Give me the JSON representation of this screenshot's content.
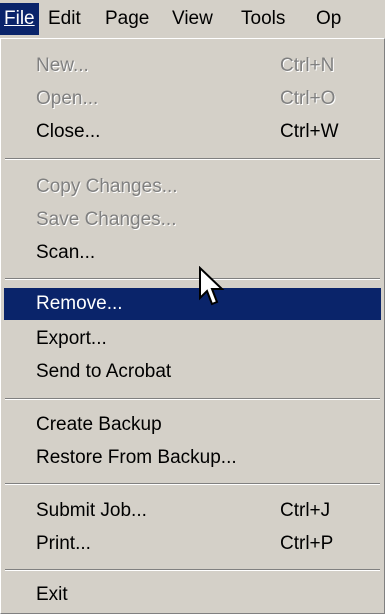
{
  "menubar": {
    "items": [
      {
        "label": "File",
        "active": true
      },
      {
        "label": "Edit"
      },
      {
        "label": "Page"
      },
      {
        "label": "View"
      },
      {
        "label": "Tools"
      },
      {
        "label": "Op"
      }
    ]
  },
  "menu": {
    "new": {
      "label": "New...",
      "shortcut": "Ctrl+N"
    },
    "open": {
      "label": "Open...",
      "shortcut": "Ctrl+O"
    },
    "close": {
      "label": "Close...",
      "shortcut": "Ctrl+W"
    },
    "copy_changes": {
      "label": "Copy Changes..."
    },
    "save_changes": {
      "label": "Save Changes..."
    },
    "scan": {
      "label": "Scan..."
    },
    "remove": {
      "label": "Remove..."
    },
    "export": {
      "label": "Export..."
    },
    "send_to_acrobat": {
      "label": "Send to Acrobat"
    },
    "create_backup": {
      "label": "Create Backup"
    },
    "restore_backup": {
      "label": "Restore From Backup..."
    },
    "submit_job": {
      "label": "Submit Job...",
      "shortcut": "Ctrl+J"
    },
    "print": {
      "label": "Print...",
      "shortcut": "Ctrl+P"
    },
    "exit": {
      "label": "Exit"
    }
  },
  "colors": {
    "menu_bg": "#d4d0c8",
    "highlight": "#0a246a",
    "disabled_text": "#808080"
  },
  "cursor_icon": "arrow-pointer-icon"
}
